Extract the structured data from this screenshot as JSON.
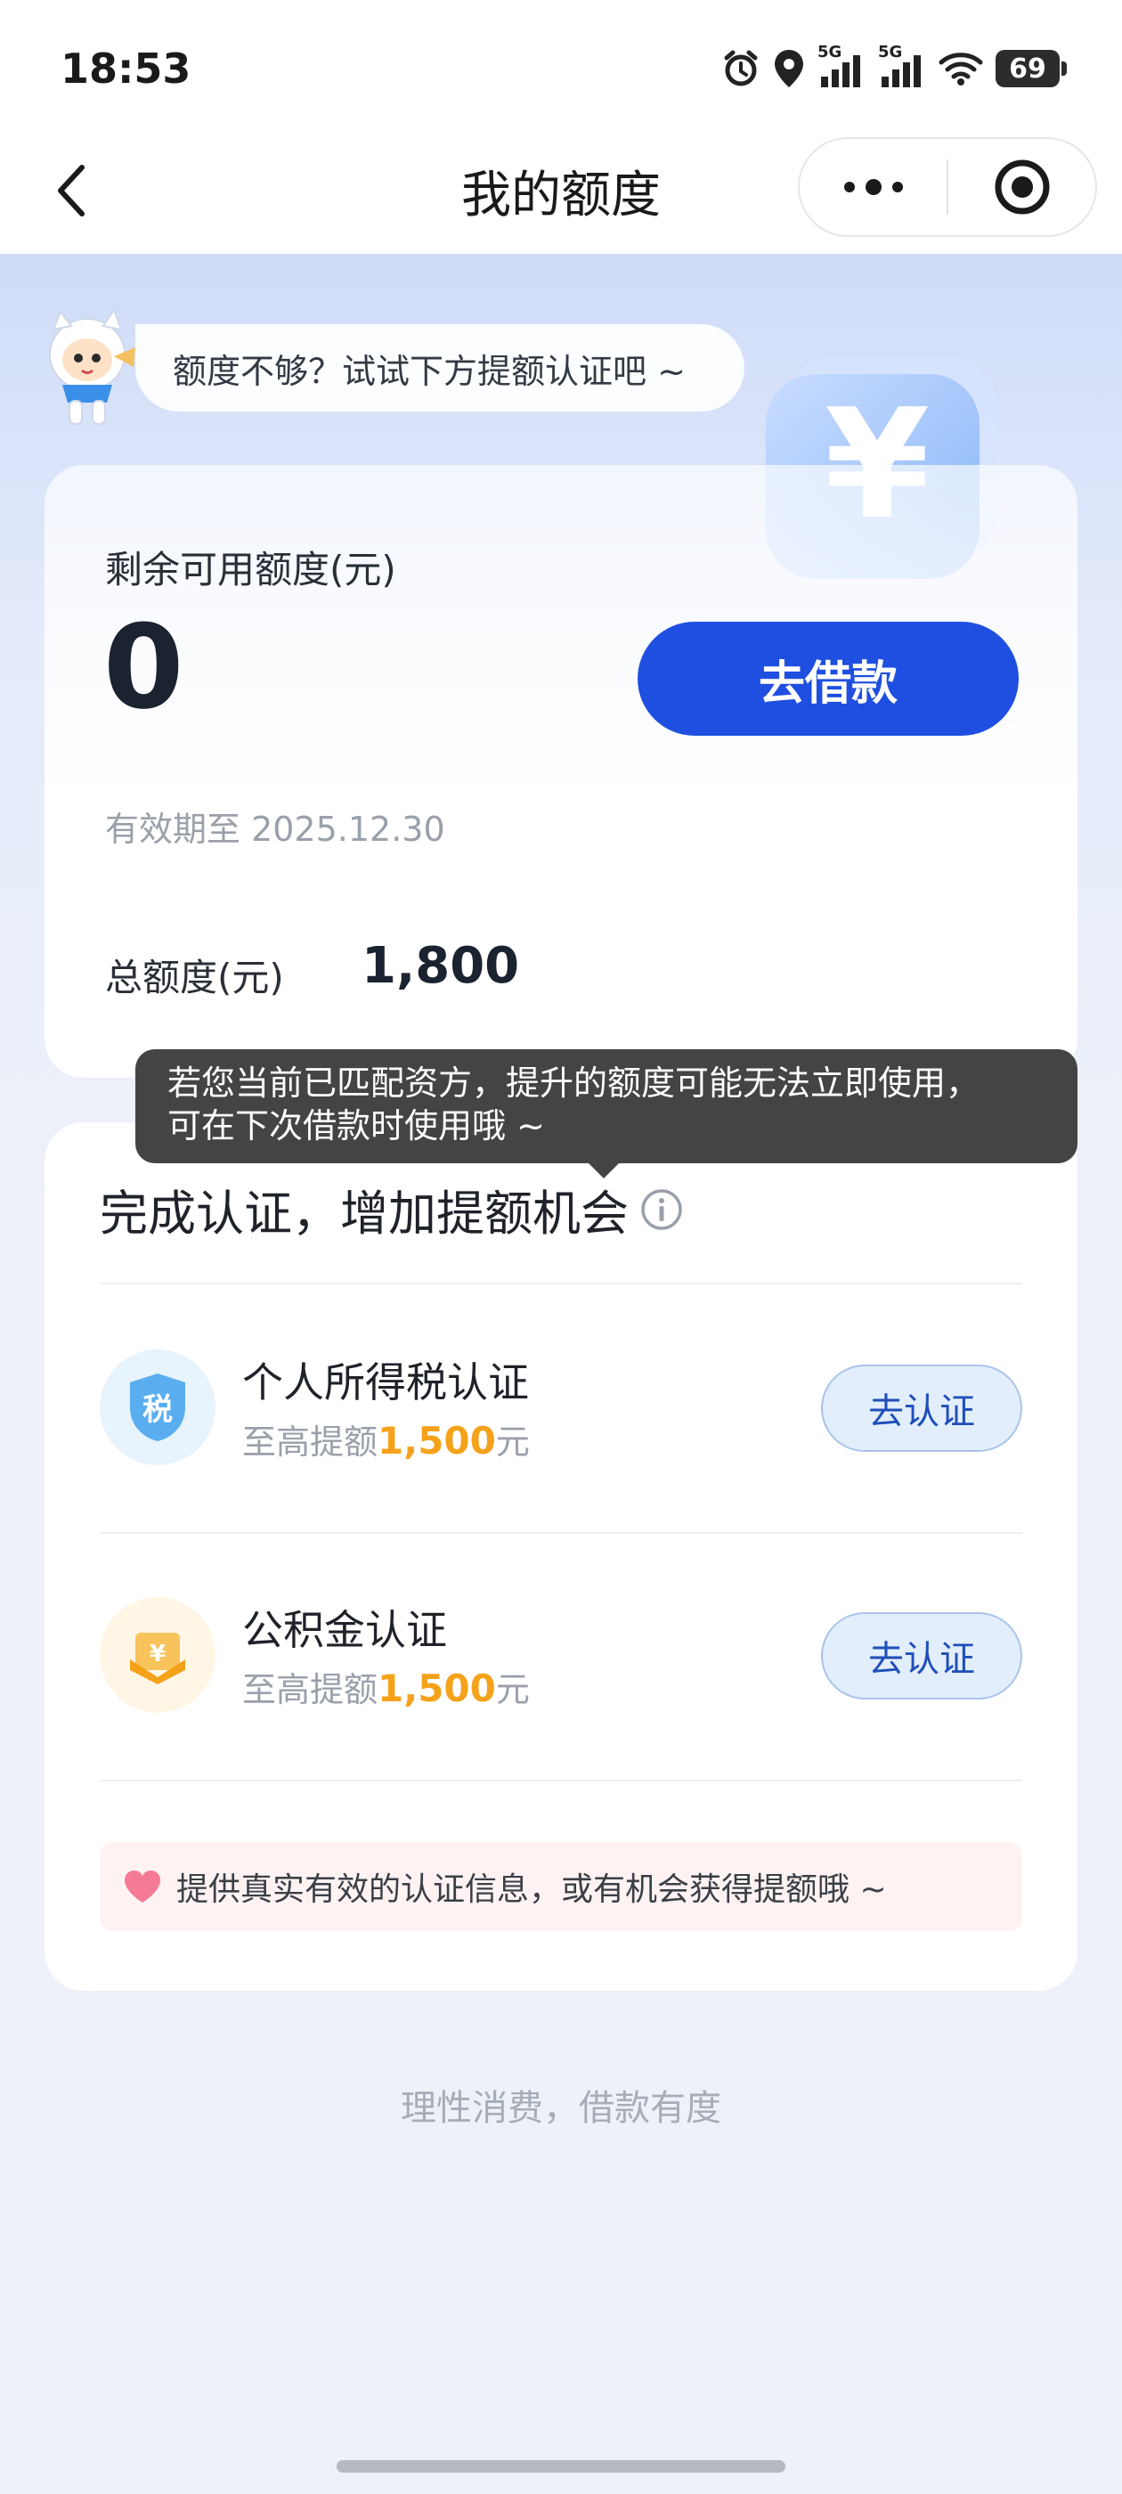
{
  "status_bar": {
    "time": "18:53",
    "signal_1_label": "5G",
    "signal_2_label": "5G",
    "battery": "69"
  },
  "nav": {
    "title": "我的额度"
  },
  "hero": {
    "speech": "额度不够？试试下方提额认证吧 ~",
    "yuan_symbol": "¥"
  },
  "quota": {
    "remain_label": "剩余可用额度(元)",
    "remain_value": "0",
    "borrow_button": "去借款",
    "validity": "有效期至 2025.12.30",
    "total_label": "总额度(元)",
    "total_value": "1,800"
  },
  "tooltip": {
    "line1": "若您当前已匹配资方，提升的额度可能无法立即使用，",
    "line2": "可在下次借款时使用哦 ~"
  },
  "certification": {
    "title": "完成认证，增加提额机会",
    "items": [
      {
        "icon_text": "税",
        "name": "个人所得税认证",
        "sub_prefix": "至高提额",
        "amount": "1,500",
        "sub_suffix": "元",
        "button": "去认证",
        "icon_color": "#5aaef0"
      },
      {
        "icon_text": "¥",
        "name": "公积金认证",
        "sub_prefix": "至高提额",
        "amount": "1,500",
        "sub_suffix": "元",
        "button": "去认证",
        "icon_color": "#f7c35a"
      }
    ],
    "notice": "提供真实有效的认证信息，或有机会获得提额哦 ~"
  },
  "footer": {
    "slogan": "理性消费，借款有度"
  },
  "colors": {
    "primary": "#1f4fe0",
    "amount_highlight": "#f5a21b",
    "tooltip_bg": "#444444"
  }
}
